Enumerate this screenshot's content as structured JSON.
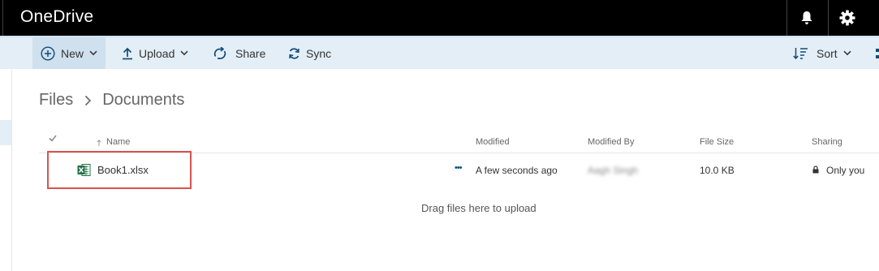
{
  "app": {
    "title": "OneDrive"
  },
  "toolbar": {
    "new_label": "New",
    "upload_label": "Upload",
    "share_label": "Share",
    "sync_label": "Sync",
    "sort_label": "Sort"
  },
  "breadcrumb": {
    "root": "Files",
    "current": "Documents"
  },
  "table": {
    "headers": {
      "name": "Name",
      "modified": "Modified",
      "modified_by": "Modified By",
      "file_size": "File Size",
      "sharing": "Sharing"
    },
    "rows": [
      {
        "name": "Book1.xlsx",
        "more": "•••",
        "modified": "A few seconds ago",
        "modified_by": "Aagh Singh",
        "file_size": "10.0 KB",
        "sharing": "Only you"
      }
    ]
  },
  "drop_hint": "Drag files here to upload",
  "colors": {
    "topbar": "#000000",
    "commandbar": "#e4eef6",
    "highlight": "#d9534f",
    "excel_green": "#1e7145",
    "accent": "#0072c6"
  },
  "icons": [
    "bell-icon",
    "gear-icon",
    "plus-circle-icon",
    "upload-icon",
    "share-icon",
    "sync-icon",
    "sort-icon",
    "excel-file-icon",
    "lock-icon",
    "check-icon",
    "chevron-right-icon"
  ]
}
